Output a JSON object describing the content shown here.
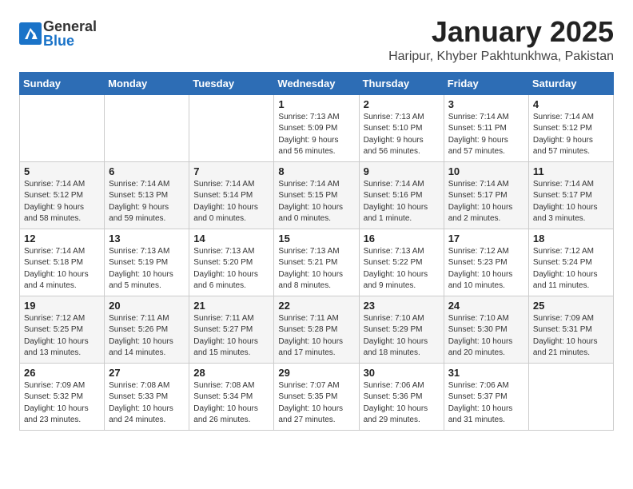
{
  "logo": {
    "general": "General",
    "blue": "Blue"
  },
  "header": {
    "month": "January 2025",
    "location": "Haripur, Khyber Pakhtunkhwa, Pakistan"
  },
  "weekdays": [
    "Sunday",
    "Monday",
    "Tuesday",
    "Wednesday",
    "Thursday",
    "Friday",
    "Saturday"
  ],
  "weeks": [
    [
      {
        "day": "",
        "info": ""
      },
      {
        "day": "",
        "info": ""
      },
      {
        "day": "",
        "info": ""
      },
      {
        "day": "1",
        "info": "Sunrise: 7:13 AM\nSunset: 5:09 PM\nDaylight: 9 hours\nand 56 minutes."
      },
      {
        "day": "2",
        "info": "Sunrise: 7:13 AM\nSunset: 5:10 PM\nDaylight: 9 hours\nand 56 minutes."
      },
      {
        "day": "3",
        "info": "Sunrise: 7:14 AM\nSunset: 5:11 PM\nDaylight: 9 hours\nand 57 minutes."
      },
      {
        "day": "4",
        "info": "Sunrise: 7:14 AM\nSunset: 5:12 PM\nDaylight: 9 hours\nand 57 minutes."
      }
    ],
    [
      {
        "day": "5",
        "info": "Sunrise: 7:14 AM\nSunset: 5:12 PM\nDaylight: 9 hours\nand 58 minutes."
      },
      {
        "day": "6",
        "info": "Sunrise: 7:14 AM\nSunset: 5:13 PM\nDaylight: 9 hours\nand 59 minutes."
      },
      {
        "day": "7",
        "info": "Sunrise: 7:14 AM\nSunset: 5:14 PM\nDaylight: 10 hours\nand 0 minutes."
      },
      {
        "day": "8",
        "info": "Sunrise: 7:14 AM\nSunset: 5:15 PM\nDaylight: 10 hours\nand 0 minutes."
      },
      {
        "day": "9",
        "info": "Sunrise: 7:14 AM\nSunset: 5:16 PM\nDaylight: 10 hours\nand 1 minute."
      },
      {
        "day": "10",
        "info": "Sunrise: 7:14 AM\nSunset: 5:17 PM\nDaylight: 10 hours\nand 2 minutes."
      },
      {
        "day": "11",
        "info": "Sunrise: 7:14 AM\nSunset: 5:17 PM\nDaylight: 10 hours\nand 3 minutes."
      }
    ],
    [
      {
        "day": "12",
        "info": "Sunrise: 7:14 AM\nSunset: 5:18 PM\nDaylight: 10 hours\nand 4 minutes."
      },
      {
        "day": "13",
        "info": "Sunrise: 7:13 AM\nSunset: 5:19 PM\nDaylight: 10 hours\nand 5 minutes."
      },
      {
        "day": "14",
        "info": "Sunrise: 7:13 AM\nSunset: 5:20 PM\nDaylight: 10 hours\nand 6 minutes."
      },
      {
        "day": "15",
        "info": "Sunrise: 7:13 AM\nSunset: 5:21 PM\nDaylight: 10 hours\nand 8 minutes."
      },
      {
        "day": "16",
        "info": "Sunrise: 7:13 AM\nSunset: 5:22 PM\nDaylight: 10 hours\nand 9 minutes."
      },
      {
        "day": "17",
        "info": "Sunrise: 7:12 AM\nSunset: 5:23 PM\nDaylight: 10 hours\nand 10 minutes."
      },
      {
        "day": "18",
        "info": "Sunrise: 7:12 AM\nSunset: 5:24 PM\nDaylight: 10 hours\nand 11 minutes."
      }
    ],
    [
      {
        "day": "19",
        "info": "Sunrise: 7:12 AM\nSunset: 5:25 PM\nDaylight: 10 hours\nand 13 minutes."
      },
      {
        "day": "20",
        "info": "Sunrise: 7:11 AM\nSunset: 5:26 PM\nDaylight: 10 hours\nand 14 minutes."
      },
      {
        "day": "21",
        "info": "Sunrise: 7:11 AM\nSunset: 5:27 PM\nDaylight: 10 hours\nand 15 minutes."
      },
      {
        "day": "22",
        "info": "Sunrise: 7:11 AM\nSunset: 5:28 PM\nDaylight: 10 hours\nand 17 minutes."
      },
      {
        "day": "23",
        "info": "Sunrise: 7:10 AM\nSunset: 5:29 PM\nDaylight: 10 hours\nand 18 minutes."
      },
      {
        "day": "24",
        "info": "Sunrise: 7:10 AM\nSunset: 5:30 PM\nDaylight: 10 hours\nand 20 minutes."
      },
      {
        "day": "25",
        "info": "Sunrise: 7:09 AM\nSunset: 5:31 PM\nDaylight: 10 hours\nand 21 minutes."
      }
    ],
    [
      {
        "day": "26",
        "info": "Sunrise: 7:09 AM\nSunset: 5:32 PM\nDaylight: 10 hours\nand 23 minutes."
      },
      {
        "day": "27",
        "info": "Sunrise: 7:08 AM\nSunset: 5:33 PM\nDaylight: 10 hours\nand 24 minutes."
      },
      {
        "day": "28",
        "info": "Sunrise: 7:08 AM\nSunset: 5:34 PM\nDaylight: 10 hours\nand 26 minutes."
      },
      {
        "day": "29",
        "info": "Sunrise: 7:07 AM\nSunset: 5:35 PM\nDaylight: 10 hours\nand 27 minutes."
      },
      {
        "day": "30",
        "info": "Sunrise: 7:06 AM\nSunset: 5:36 PM\nDaylight: 10 hours\nand 29 minutes."
      },
      {
        "day": "31",
        "info": "Sunrise: 7:06 AM\nSunset: 5:37 PM\nDaylight: 10 hours\nand 31 minutes."
      },
      {
        "day": "",
        "info": ""
      }
    ]
  ]
}
